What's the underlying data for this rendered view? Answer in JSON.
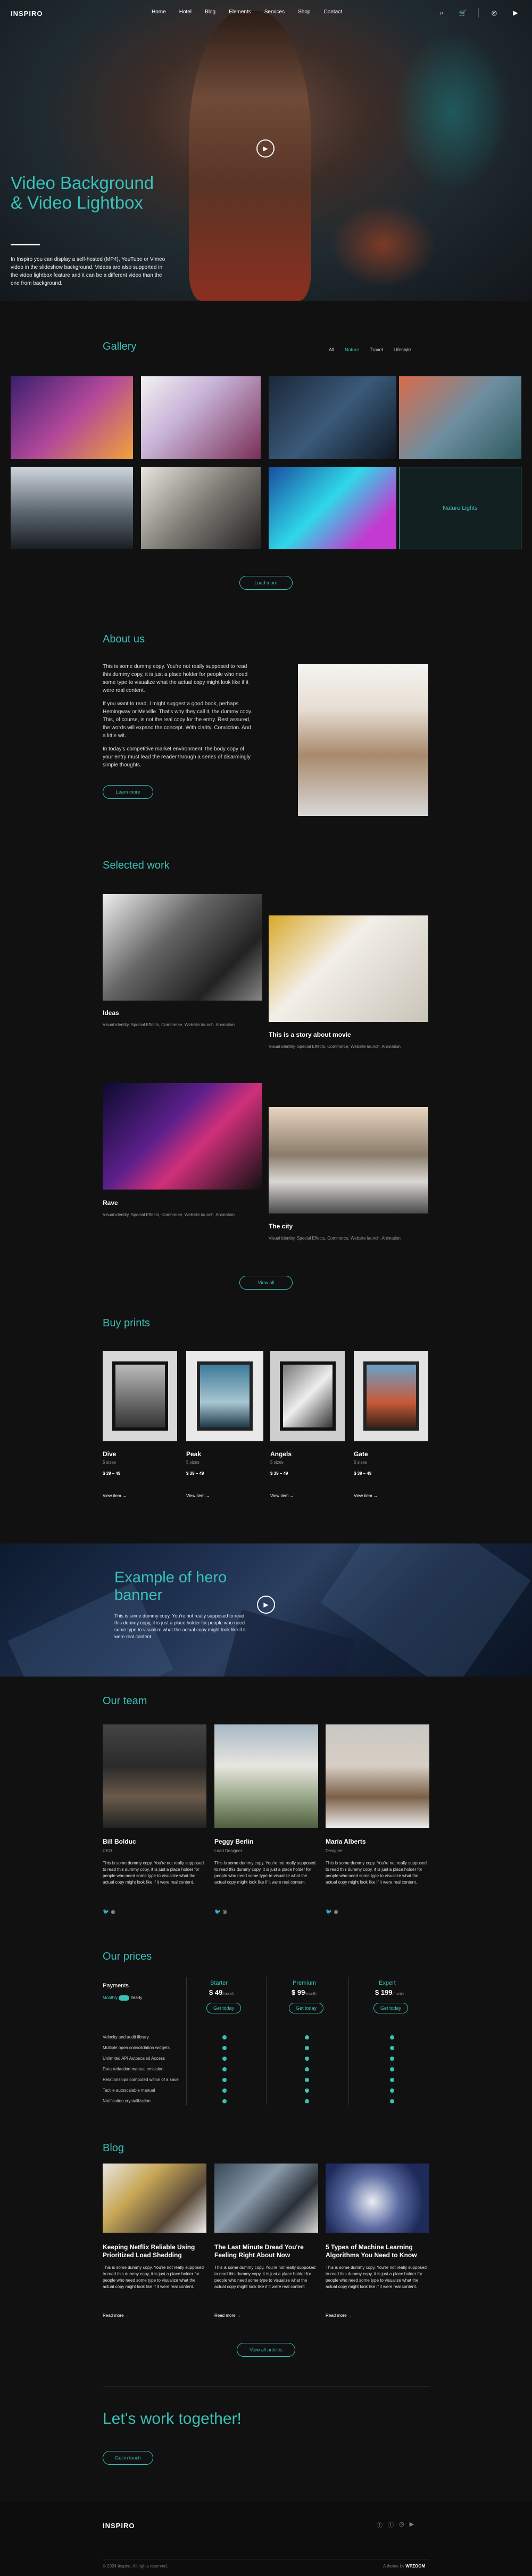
{
  "brand": "INSPIRO",
  "nav": [
    "Home",
    "Hotel",
    "Blog",
    "Elements",
    "Services",
    "Shop",
    "Contact"
  ],
  "hero": {
    "title": "Video Background & Video Lightbox",
    "text": "In Inspiro you can display a self-hosted (MP4), YouTube or Vimeo video in the slideshow background. Videos are also supported in the video lightbox feature and it can be a different video than the one from background."
  },
  "gallery": {
    "title": "Gallery",
    "filters": [
      "All",
      "Nature",
      "Travel",
      "Lifestyle"
    ],
    "active": "Nature",
    "hover_label": "Nature Lights",
    "button": "Load more"
  },
  "about": {
    "title": "About us",
    "p1": "This is some dummy copy. You're not really supposed to read this dummy copy, it is just a place holder for people who need some type to visualize what the actual copy might look like if it were real content.",
    "p2": "If you want to read, I might suggest a good book, perhaps Hemingway or Melville. That's why they call it, the dummy copy. This, of course, is not the real copy for the entry. Rest assured, the words will expand the concept. With clarity. Conviction. And a little wit.",
    "p3": "In today's competitive market environment, the body copy of your entry must lead the reader through a series of disarmingly simple thoughts.",
    "button": "Learn more"
  },
  "work": {
    "title": "Selected work",
    "items": [
      {
        "title": "Ideas",
        "meta": "Visual identity, Special Effects, Commerce, Website launch, Animation"
      },
      {
        "title": "This is a story about movie",
        "meta": "Visual identity, Special Effects, Commerce, Website launch, Animation"
      },
      {
        "title": "Rave",
        "meta": "Visual identity, Special Effects, Commerce, Website launch, Animation"
      },
      {
        "title": "The city",
        "meta": "Visual identity, Special Effects, Commerce, Website launch, Animation"
      }
    ],
    "button": "View all"
  },
  "prints": {
    "title": "Buy prints",
    "items": [
      {
        "name": "Dive",
        "sub": "5 sizes",
        "price": "$ 39 – 49",
        "link": "View item"
      },
      {
        "name": "Peak",
        "sub": "5 sizes",
        "price": "$ 39 – 49",
        "link": "View item"
      },
      {
        "name": "Angels",
        "sub": "5 sizes",
        "price": "$ 39 – 49",
        "link": "View item"
      },
      {
        "name": "Gate",
        "sub": "5 sizes",
        "price": "$ 39 – 49",
        "link": "View item"
      }
    ]
  },
  "banner": {
    "title": "Example of hero banner",
    "text": "This is some dummy copy. You're not really supposed to read this dummy copy, it is just a place holder for people who need some type to visualize what the actual copy might look like if it were real content."
  },
  "team": {
    "title": "Our team",
    "members": [
      {
        "name": "Bill Bolduc",
        "role": "CEO",
        "bio": "This is some dummy copy. You're not really supposed to read this dummy copy, it is just a place holder for people who need some type to visualize what the actual copy might look like if it were real content."
      },
      {
        "name": "Peggy Berlin",
        "role": "Lead Designer",
        "bio": "This is some dummy copy. You're not really supposed to read this dummy copy, it is just a place holder for people who need some type to visualize what the actual copy might look like if it were real content."
      },
      {
        "name": "Maria Alberts",
        "role": "Designer",
        "bio": "This is some dummy copy. You're not really supposed to read this dummy copy, it is just a place holder for people who need some type to visualize what the actual copy might look like if it were real content."
      }
    ]
  },
  "prices": {
    "title": "Our prices",
    "payments": "Payments",
    "monthly": "Monthly",
    "yearly": "Yearly",
    "plans": [
      {
        "name": "Starter",
        "price": "$ 49",
        "per": "/month",
        "btn": "Get today"
      },
      {
        "name": "Premium",
        "price": "$ 99",
        "per": "/month",
        "btn": "Get today"
      },
      {
        "name": "Expert",
        "price": "$ 199",
        "per": "/month",
        "btn": "Get today"
      }
    ],
    "features": [
      "Velocity and audit library",
      "Multiple open consolidation widgets",
      "Unlimited API Autoscaled Access",
      "Data redaction manual emission",
      "Relationships computed within of a save",
      "Tactile autoscalable manual",
      "Notification crystallization"
    ]
  },
  "blog": {
    "title": "Blog",
    "posts": [
      {
        "title": "Keeping Netflix Reliable Using Prioritized Load Shedding",
        "text": "This is some dummy copy. You're not really supposed to read this dummy copy, it is just a place holder for people who need some type to visualize what the actual copy might look like if it were real content.",
        "link": "Read more"
      },
      {
        "title": "The Last Minute Dread You're Feeling Right About Now",
        "text": "This is some dummy copy. You're not really supposed to read this dummy copy, it is just a place holder for people who need some type to visualize what the actual copy might look like if it were real content.",
        "link": "Read more"
      },
      {
        "title": "5 Types of Machine Learning Algorithms You Need to Know",
        "text": "This is some dummy copy. You're not really supposed to read this dummy copy, it is just a place holder for people who need some type to visualize what the actual copy might look like if it were real content.",
        "link": "Read more"
      }
    ],
    "button": "View all articles"
  },
  "cta": {
    "title": "Let's work together!",
    "button": "Get in touch"
  },
  "footer": {
    "brand": "INSPIRO",
    "copyright": "© 2024 Inspiro. All rights reserved.",
    "credit": "A theme by",
    "credit_brand": "WPZOOM"
  }
}
